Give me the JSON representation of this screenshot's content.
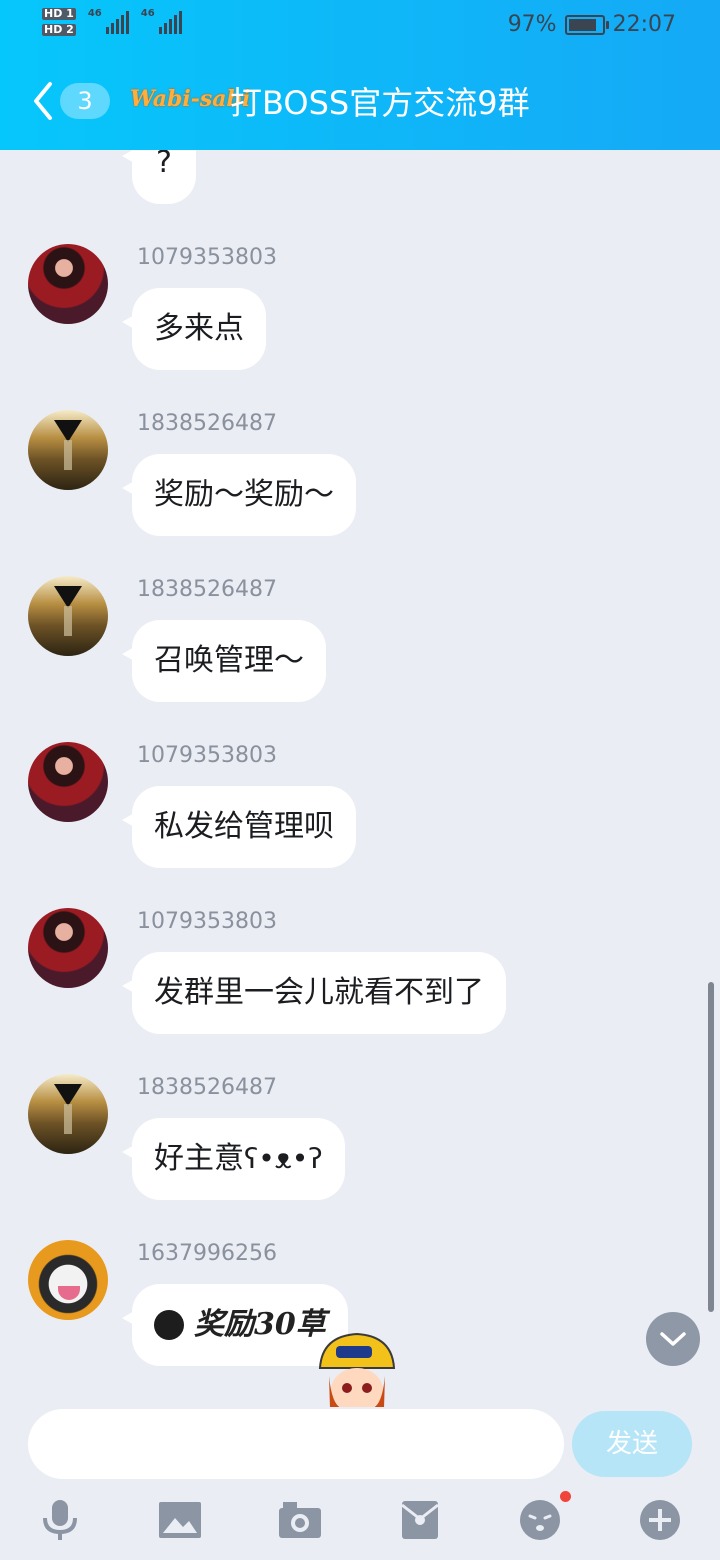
{
  "status_bar": {
    "hd1": "HD 1",
    "hd2": "HD 2",
    "net1": "46",
    "net2": "46",
    "battery_percent": "97%",
    "battery_level": 0.97,
    "time": "22:07"
  },
  "header": {
    "back_badge": "3",
    "logo_text": "Wabi-sabi",
    "title": "打BOSS官方交流9群"
  },
  "messages": [
    {
      "sender": "",
      "text": "?",
      "avatar": "girl"
    },
    {
      "sender": "1079353803",
      "text": "多来点",
      "avatar": "girl"
    },
    {
      "sender": "1838526487",
      "text": "奖励～奖励～",
      "avatar": "hourglass"
    },
    {
      "sender": "1838526487",
      "text": "召唤管理～",
      "avatar": "hourglass"
    },
    {
      "sender": "1079353803",
      "text": "私发给管理呗",
      "avatar": "girl"
    },
    {
      "sender": "1079353803",
      "text": "发群里一会儿就看不到了",
      "avatar": "girl"
    },
    {
      "sender": "1838526487",
      "text": "好主意",
      "emoji": "bear-emoji",
      "avatar": "hourglass"
    },
    {
      "sender": "1637996256",
      "text": "奖励30草",
      "avatar": "husky"
    }
  ],
  "input": {
    "value": "",
    "placeholder": "",
    "send_label": "发送"
  },
  "toolbar": {
    "icons": [
      "mic-icon",
      "image-icon",
      "camera-icon",
      "red-packet-icon",
      "emoji-icon",
      "plus-icon"
    ],
    "emoji_has_notification": true
  },
  "colors": {
    "header_start": "#06c7fb",
    "header_end": "#15a9f6",
    "background": "#eaedf4",
    "send_button": "#b5e5f6",
    "notification": "#f0453a"
  }
}
